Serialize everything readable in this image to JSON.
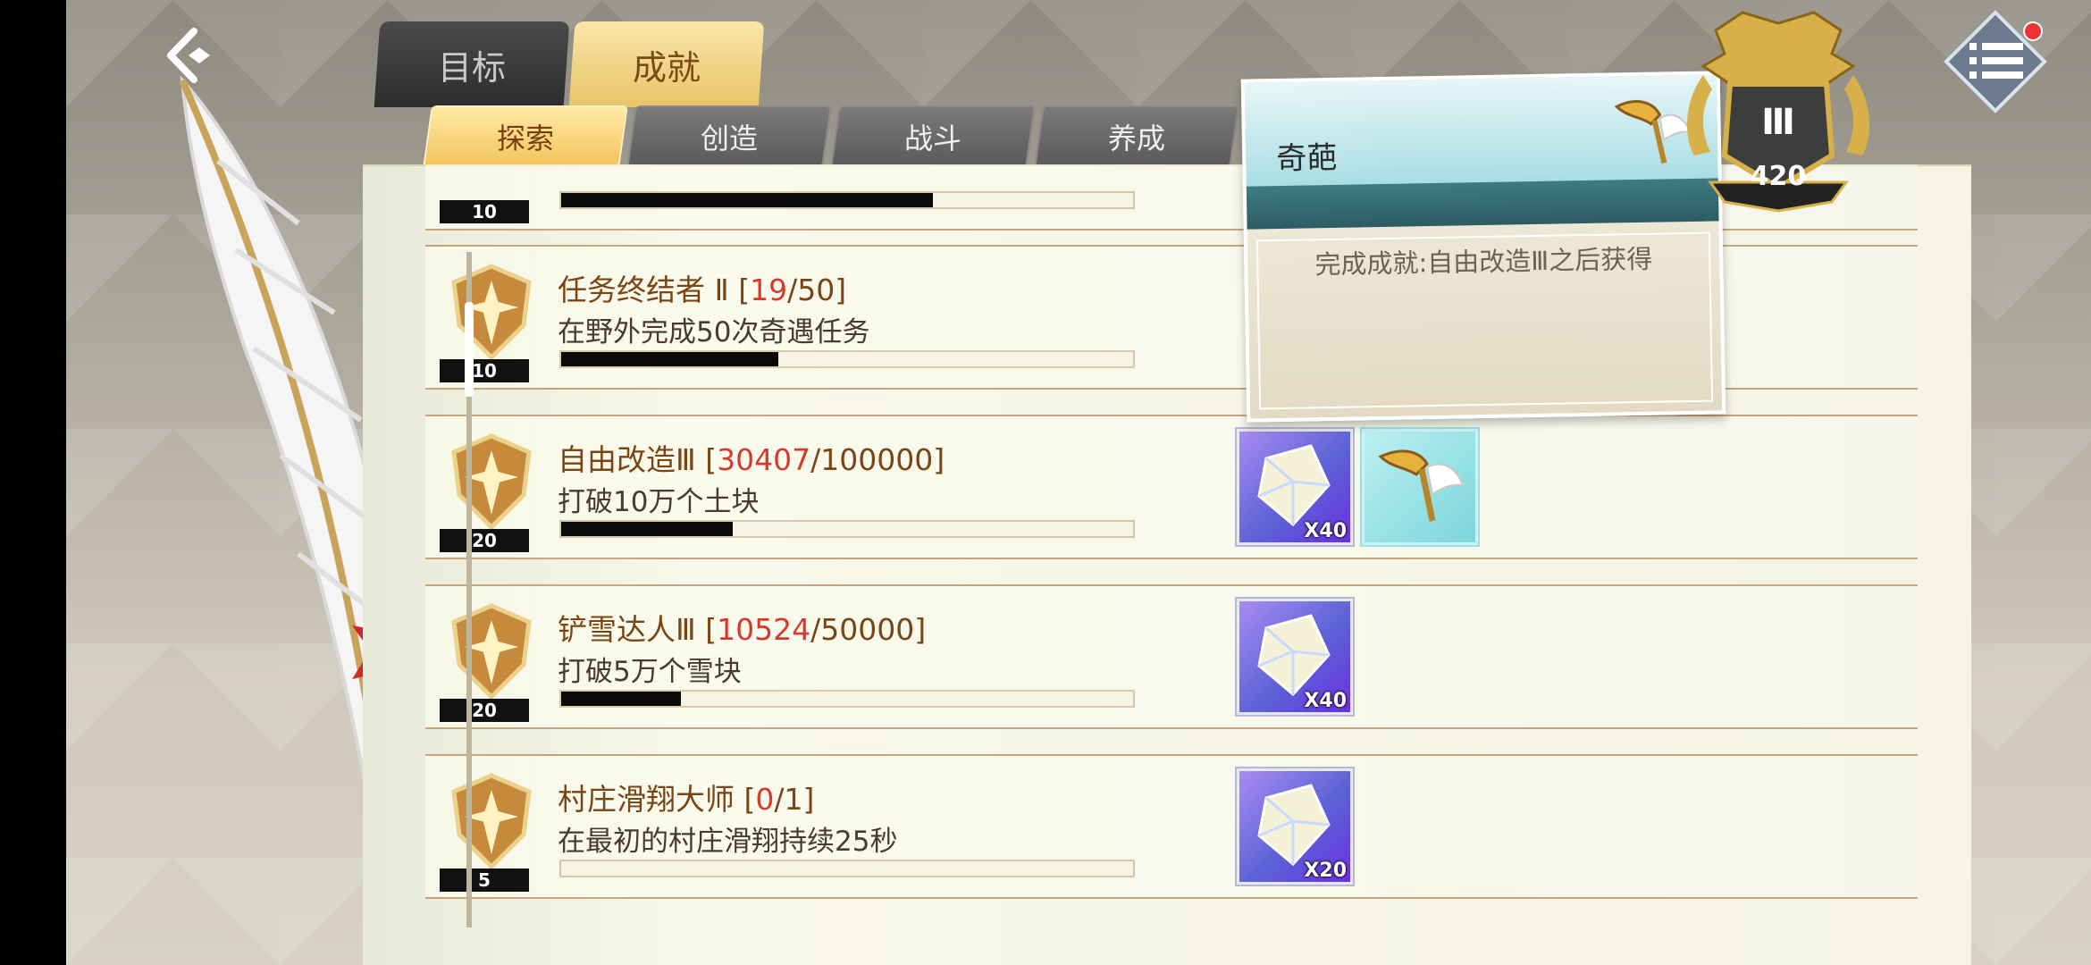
{
  "tabs": {
    "main": [
      {
        "label": "目标",
        "active": false
      },
      {
        "label": "成就",
        "active": true
      }
    ],
    "sub": [
      {
        "label": "探索",
        "active": true
      },
      {
        "label": "创造",
        "active": false
      },
      {
        "label": "战斗",
        "active": false
      },
      {
        "label": "养成",
        "active": false
      }
    ]
  },
  "trophy": {
    "rank": "Ⅲ",
    "points": "420"
  },
  "tooltip": {
    "title": "奇葩",
    "description": "完成成就:自由改造Ⅲ之后获得",
    "icon": "trumpet-icon"
  },
  "achievements": [
    {
      "level": "10",
      "title": "",
      "progress_current": "",
      "progress_total": "",
      "description": "",
      "fill_fraction": 0.65,
      "rewards": []
    },
    {
      "level": "10",
      "title": "任务终结者 Ⅱ",
      "open_bracket": "[",
      "progress_current": "19",
      "slash": "/",
      "progress_total": "50",
      "close_bracket": "]",
      "description": "在野外完成50次奇遇任务",
      "fill_fraction": 0.38,
      "rewards": []
    },
    {
      "level": "20",
      "title": "自由改造Ⅲ",
      "open_bracket": "[",
      "progress_current": "30407",
      "slash": "/",
      "progress_total": "100000",
      "close_bracket": "]",
      "description": "打破10万个土块",
      "fill_fraction": 0.3,
      "rewards": [
        {
          "icon": "crystal-icon",
          "qty": "X40"
        },
        {
          "icon": "trumpet-icon",
          "qty": ""
        }
      ]
    },
    {
      "level": "20",
      "title": "铲雪达人Ⅲ",
      "open_bracket": "[",
      "progress_current": "10524",
      "slash": "/",
      "progress_total": "50000",
      "close_bracket": "]",
      "description": "打破5万个雪块",
      "fill_fraction": 0.21,
      "rewards": [
        {
          "icon": "crystal-icon",
          "qty": "X40"
        }
      ]
    },
    {
      "level": "5",
      "title": "村庄滑翔大师",
      "open_bracket": "[",
      "progress_current": "0",
      "slash": "/",
      "progress_total": "1",
      "close_bracket": "]",
      "description": "在最初的村庄滑翔持续25秒",
      "fill_fraction": 0.0,
      "rewards": [
        {
          "icon": "crystal-icon",
          "qty": "X20"
        }
      ]
    }
  ],
  "colors": {
    "progress_red": "#d43a2e",
    "title_brown": "#7a4414",
    "tab_active": "#f3c45a"
  }
}
